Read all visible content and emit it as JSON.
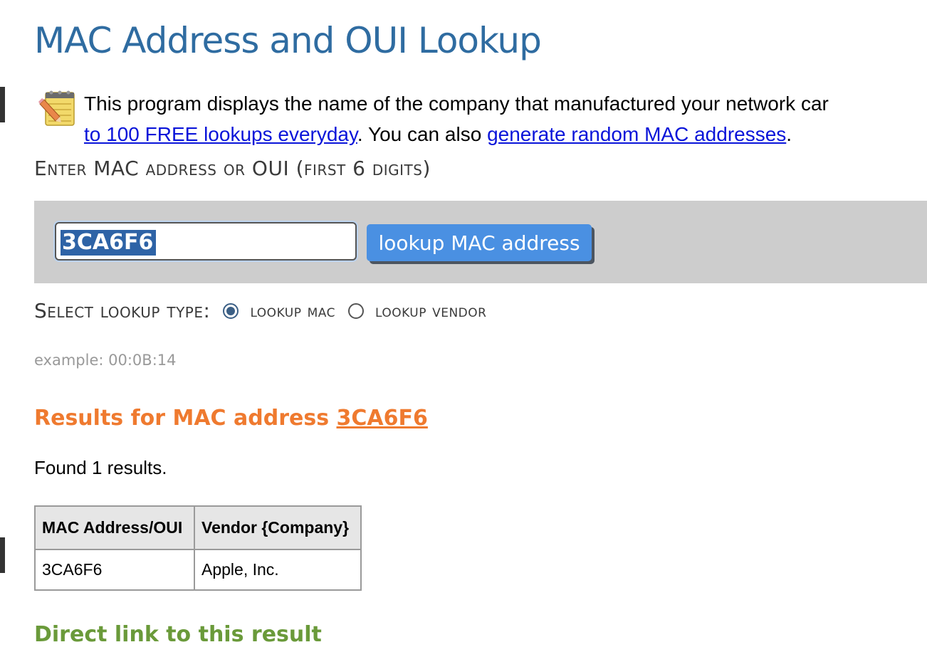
{
  "page": {
    "title": "MAC Address and OUI Lookup"
  },
  "intro": {
    "text_1": "This program displays the name of the company that manufactured your network car",
    "link_free": "to 100 FREE lookups everyday",
    "text_2": ". You can also ",
    "link_generate": "generate random MAC addresses",
    "text_3": "."
  },
  "form": {
    "enter_label": "Enter MAC address or OUI (first 6 digits)",
    "input_value": "3CA6F6",
    "button_label": "lookup MAC address",
    "select_type_label": "Select lookup type:",
    "options": [
      {
        "label": "lookup mac",
        "selected": true
      },
      {
        "label": "lookup vendor",
        "selected": false
      }
    ],
    "example": "example: 00:0B:14"
  },
  "results": {
    "heading_prefix": "Results for MAC address ",
    "heading_link": "3CA6F6",
    "found_text": "Found 1 results.",
    "table": {
      "headers": [
        "MAC Address/OUI",
        "Vendor {Company}"
      ],
      "rows": [
        [
          "3CA6F6",
          "Apple, Inc."
        ]
      ]
    },
    "next_heading_partial": "Direct link to this result"
  },
  "colors": {
    "title": "#2f6ca1",
    "button": "#4a90e2",
    "results_heading": "#ef7a2f",
    "link": "#0a14d9",
    "lookup_bar": "#cdcdcd"
  }
}
